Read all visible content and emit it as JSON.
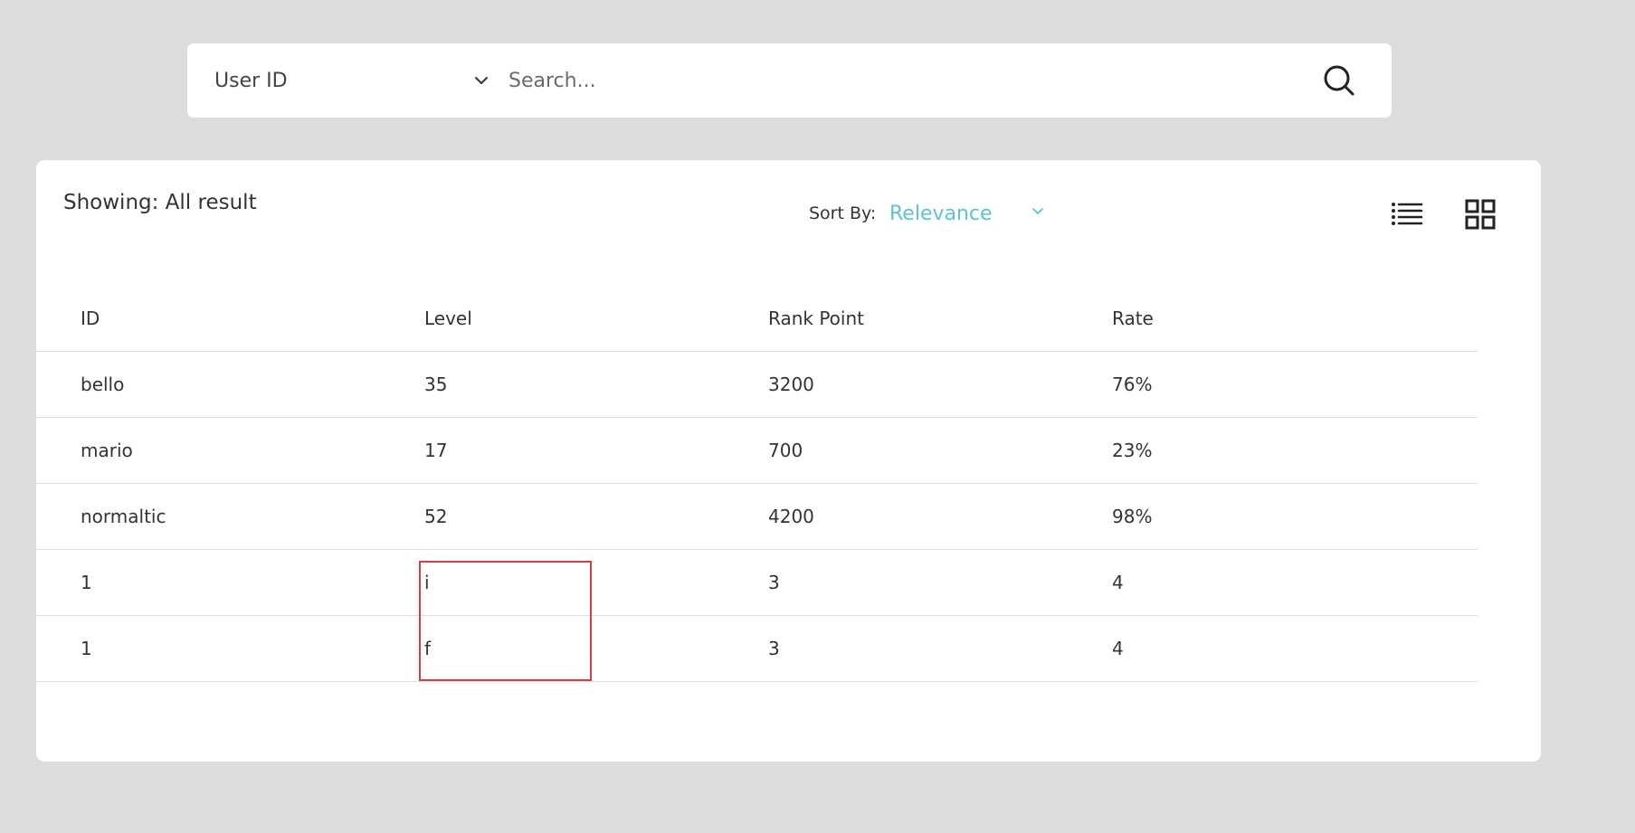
{
  "search": {
    "field_select": "User ID",
    "placeholder": "Search...",
    "value": ""
  },
  "results": {
    "showing_label": "Showing: All result",
    "sort_label": "Sort By:",
    "sort_value": "Relevance",
    "accent_color": "#5bc4cf",
    "view_icons": [
      "list-view-icon",
      "grid-view-icon"
    ]
  },
  "table": {
    "columns": [
      "ID",
      "Level",
      "Rank Point",
      "Rate"
    ],
    "rows": [
      [
        "bello",
        "35",
        "3200",
        "76%"
      ],
      [
        "mario",
        "17",
        "700",
        "23%"
      ],
      [
        "normaltic",
        "52",
        "4200",
        "98%"
      ],
      [
        "1",
        "i",
        "3",
        "4"
      ],
      [
        "1",
        "f",
        "3",
        "4"
      ]
    ]
  },
  "highlight": {
    "color": "#dd3b3b"
  }
}
